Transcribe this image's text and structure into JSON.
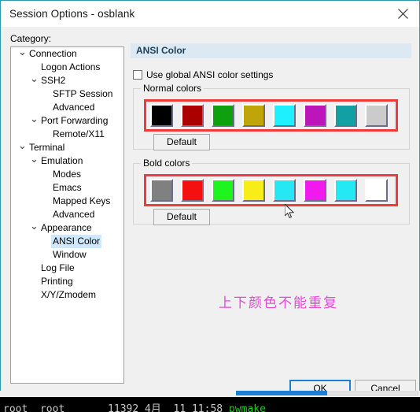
{
  "window": {
    "title": "Session Options - osblank",
    "close_icon": "close-icon"
  },
  "category": {
    "label": "Category:",
    "items": [
      {
        "label": "Connection",
        "indent": 0,
        "twisty": "v"
      },
      {
        "label": "Logon Actions",
        "indent": 1,
        "twisty": ""
      },
      {
        "label": "SSH2",
        "indent": 1,
        "twisty": "v"
      },
      {
        "label": "SFTP Session",
        "indent": 2,
        "twisty": ""
      },
      {
        "label": "Advanced",
        "indent": 2,
        "twisty": ""
      },
      {
        "label": "Port Forwarding",
        "indent": 1,
        "twisty": "v"
      },
      {
        "label": "Remote/X11",
        "indent": 2,
        "twisty": ""
      },
      {
        "label": "Terminal",
        "indent": 0,
        "twisty": "v"
      },
      {
        "label": "Emulation",
        "indent": 1,
        "twisty": "v"
      },
      {
        "label": "Modes",
        "indent": 2,
        "twisty": ""
      },
      {
        "label": "Emacs",
        "indent": 2,
        "twisty": ""
      },
      {
        "label": "Mapped Keys",
        "indent": 2,
        "twisty": ""
      },
      {
        "label": "Advanced",
        "indent": 2,
        "twisty": ""
      },
      {
        "label": "Appearance",
        "indent": 1,
        "twisty": "v"
      },
      {
        "label": "ANSI Color",
        "indent": 2,
        "twisty": "",
        "selected": true
      },
      {
        "label": "Window",
        "indent": 2,
        "twisty": ""
      },
      {
        "label": "Log File",
        "indent": 1,
        "twisty": ""
      },
      {
        "label": "Printing",
        "indent": 1,
        "twisty": ""
      },
      {
        "label": "X/Y/Zmodem",
        "indent": 1,
        "twisty": ""
      }
    ]
  },
  "pane": {
    "header": "ANSI Color",
    "global_checkbox": {
      "label": "Use global ANSI color settings",
      "checked": false
    },
    "normal": {
      "group_title": "Normal colors",
      "default_label": "Default",
      "colors": [
        "#000000",
        "#aa0000",
        "#0fa00f",
        "#bfa50a",
        "#1ff0ff",
        "#bb15bb",
        "#12a0a5",
        "#cbcbcb"
      ]
    },
    "bold": {
      "group_title": "Bold colors",
      "default_label": "Default",
      "colors": [
        "#808080",
        "#f51010",
        "#1ef51e",
        "#f7ed18",
        "#25e8f5",
        "#f119ee",
        "#25e8f5",
        "#ffffff"
      ]
    },
    "highlight_color": "#ef3b3b",
    "annotation": {
      "text": "上下颜色不能重复",
      "color": "#e24ad6"
    }
  },
  "footer": {
    "ok_label": "OK",
    "cancel_label": "Cancel"
  },
  "terminal": {
    "text_before": "root  root       11392 4月  11 11:58 ",
    "filename": "pwmake"
  }
}
